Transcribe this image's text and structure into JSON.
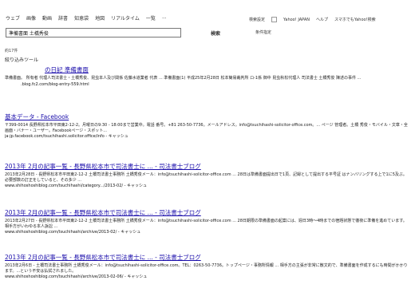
{
  "nav": {
    "items": [
      "ウェブ",
      "画像",
      "動画",
      "辞書",
      "知恵袋",
      "地図",
      "リアルタイム",
      "一覧",
      "..."
    ]
  },
  "toplinks": {
    "search_settings": "検索設定",
    "yahoo_japan": "Yahoo! JAPAN",
    "help": "ヘルプ",
    "smartphone": "スマホでもYahoo!検索"
  },
  "search": {
    "query": "準備書面 土橋秀俊",
    "button_label": "検索",
    "conditions": "条件指定"
  },
  "results_count": "約17件",
  "tools_label": "絞り込みツール",
  "results": [
    {
      "title": "の日記 準備書面",
      "description": "準備書面。 所有者 代理人司法書士・土橋秀俊、昆虫本人及び関係 佐藤水道業者 代表 ... 準備書面(1) 平成25年2月28日 松本簡易裁判所 ロ-1係 御中 昆虫秋松代理人 司法書士 土橋秀俊 陳述の事件 ...",
      "url": ".blog.fc2.com/blog-entry-559.html"
    },
    {
      "title": "基本データ - Facebook",
      "description": "〒399-0014 長野県松本市平田東2-12-2。月曜日の9:30 - 18:00まで営業中。電話 番号。+81 263-50-7736。メールアドレス。info@tsuchihashi-solicitor-office.com。... ページ 管理者。土橋 秀俊・モバイル・文章・全画面・バナー・ユーザー。Facebookページ・スポット...",
      "url": "ja-jp.facebook.com/tsuchihashi.solicitor.office/info - キャッシュ"
    },
    {
      "title": "2013年 2月の記事一覧 - 長野県松本市で司法書士に ... - 司法書士ブログ",
      "description": "2013年2月28日 - 長野県松本市平田東2-12-2 土橋司法書士事務所 土橋秀俊メール：info@tsuchihashi-solicitor-office.com ... 28日は準備書面提出日で1頁、記録として提出する平号証 はナンバリングする上で1に5及ぶ。必要部数の訂正をしていると、その多少 ...",
      "url": "www.shihoshoshiblog.com/tsuchihashi/category.../2013-02/ - キャッシュ"
    },
    {
      "title": "2013年 2月の記事一覧 - 長野県松本市で司法書士に ... - 司法書士ブログ",
      "description": "2013年2月27日 - 長野県松本市平田東2-12-2 土橋司法書士事務所 土橋秀俊メール：info@tsuchihashi-solicitor-office.com ... 28日期限の準備書面の起案には、週日3時〜4時までの宿題状態で徹夜に準備を進めています。相手方がいわゆる本人訴訟 ...",
      "url": "www.shihoshoshiblog.com/tsuchihashi/archive/2013-02/ - キャッシュ"
    },
    {
      "title": "2013年 2月の記事一覧 - 長野県松本市で司法書士に ... - 司法書士ブログ",
      "description": "2013年2月6日 - 土橋司法書士事務所 土橋秀俊メール：info@tsuchihashi-solicitor-office.com。TEL：0263-50-7736。トップページ・事務所情報 ... 相手方の主張が非常に散文的で、準備書面を作成するにも時間がかかります。...という不安は払拭されました。",
      "url": "www.shihoshoshiblog.com/tsuchihashi/archive/2013-02-06/ - キャッシュ"
    }
  ]
}
